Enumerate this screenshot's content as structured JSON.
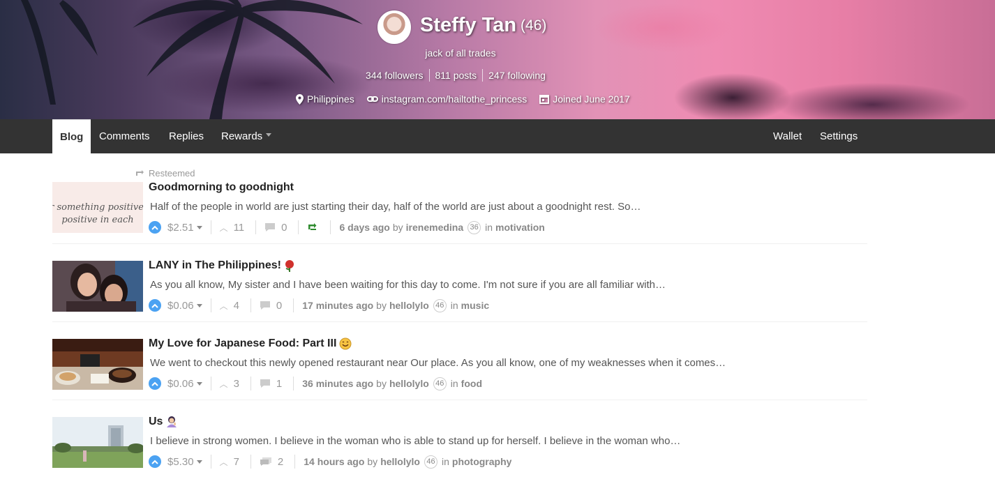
{
  "profile": {
    "name": "Steffy Tan",
    "reputation": "(46)",
    "tagline": "jack of all trades",
    "stats": {
      "followers": "344 followers",
      "posts": "811 posts",
      "following": "247 following"
    },
    "location": "Philippines",
    "website": "instagram.com/hailtothe_princess",
    "joined": "Joined June 2017"
  },
  "nav": {
    "tabs": [
      {
        "label": "Blog",
        "active": true
      },
      {
        "label": "Comments"
      },
      {
        "label": "Replies"
      },
      {
        "label": "Rewards"
      }
    ],
    "right": [
      {
        "label": "Wallet"
      },
      {
        "label": "Settings"
      }
    ]
  },
  "posts": [
    {
      "resteemed_label": "Resteemed",
      "title": "Goodmorning to goodnight",
      "excerpt": "Half of the people in world are just starting their day, half of the world are just about a goodnight rest. So…",
      "payout": "$2.51",
      "votes": "11",
      "comments": "0",
      "time": "6 days ago",
      "by": "by",
      "author": "irenemedina",
      "author_rep": "36",
      "in": "in",
      "category": "motivation",
      "thumb_text": "Look for something positive in each"
    },
    {
      "title": "LANY in The Philippines!",
      "excerpt": "As you all know, My sister and I have been waiting for this day to come. I'm not sure if you are all familiar with…",
      "payout": "$0.06",
      "votes": "4",
      "comments": "0",
      "time": "17 minutes ago",
      "by": "by",
      "author": "hellolylo",
      "author_rep": "46",
      "in": "in",
      "category": "music"
    },
    {
      "title": "My Love for Japanese Food: Part III",
      "excerpt": "We went to checkout this newly opened restaurant near Our place. As you all know, one of my weaknesses when it comes…",
      "payout": "$0.06",
      "votes": "3",
      "comments": "1",
      "time": "36 minutes ago",
      "by": "by",
      "author": "hellolylo",
      "author_rep": "46",
      "in": "in",
      "category": "food"
    },
    {
      "title": "Us",
      "excerpt": "I believe in strong women. I believe in the woman who is able to stand up for herself. I believe in the woman who…",
      "payout": "$5.30",
      "votes": "7",
      "comments": "2",
      "time": "14 hours ago",
      "by": "by",
      "author": "hellolylo",
      "author_rep": "46",
      "in": "in",
      "category": "photography"
    }
  ],
  "colors": {
    "nav_bg": "#333333",
    "upvote": "#4ba2f2",
    "resteem_green": "#2e8b2e"
  }
}
